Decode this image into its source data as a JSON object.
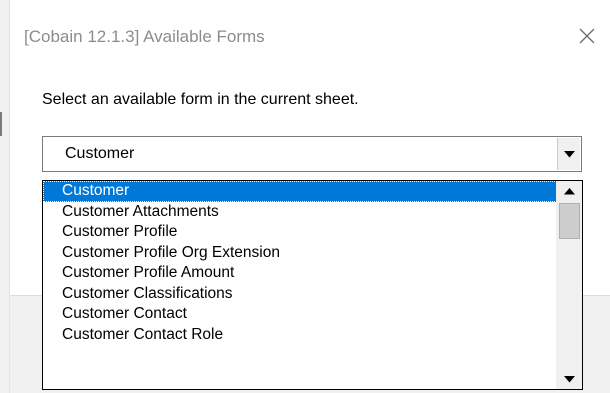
{
  "dialog": {
    "title": "[Cobain 12.1.3] Available Forms",
    "prompt": "Select an available form in the current sheet."
  },
  "form_select": {
    "selected_value": "Customer",
    "options": [
      "Customer",
      "Customer Attachments",
      "Customer Profile",
      "Customer Profile Org Extension",
      "Customer Profile Amount",
      "Customer Classifications",
      "Customer Contact",
      "Customer Contact Role"
    ],
    "highlighted_index": 0
  },
  "icons": {
    "close": "close-icon",
    "dropdown": "chevron-down-icon",
    "scroll_up": "scroll-up-arrow-icon",
    "scroll_down": "scroll-down-arrow-icon"
  },
  "colors": {
    "selection": "#0078d7",
    "title_text": "#8c8c8c"
  }
}
